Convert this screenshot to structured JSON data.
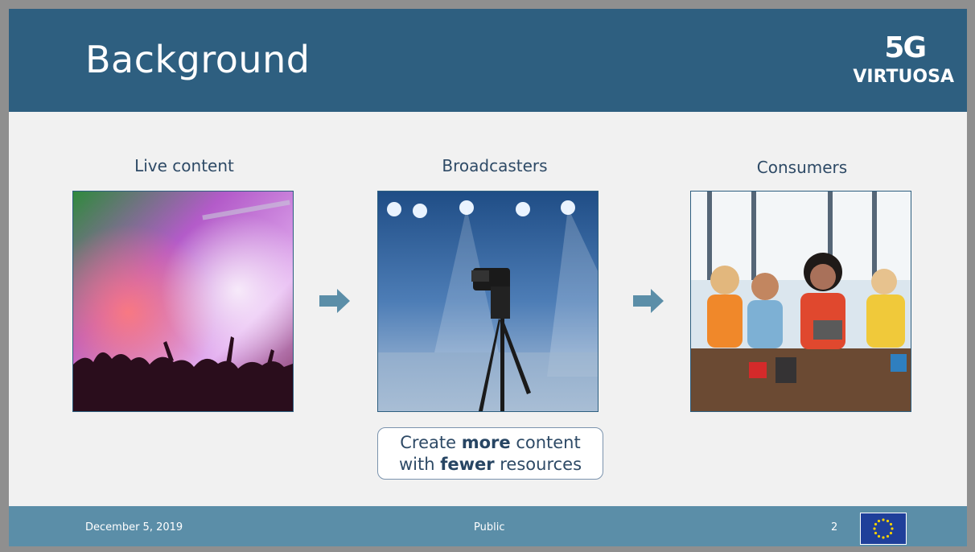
{
  "slide": {
    "title": "Background",
    "logo": {
      "top": "5G",
      "bottom": "VIRTUOSA"
    },
    "columns": [
      {
        "label": "Live content",
        "image": "concert-crowd"
      },
      {
        "label": "Broadcasters",
        "image": "video-camera-on-tripod"
      },
      {
        "label": "Consumers",
        "image": "people-using-devices"
      }
    ],
    "tagline": {
      "line1_pre": "Create ",
      "line1_bold": "more",
      "line1_post": " content",
      "line2_pre": "with ",
      "line2_bold": "fewer",
      "line2_post": " resources"
    }
  },
  "footer": {
    "date": "December 5, 2019",
    "classification": "Public",
    "page_number": "2"
  },
  "colors": {
    "header": "#2e5f80",
    "footer": "#5b8ea8",
    "arrow": "#5b8ea8",
    "text": "#2e4a66"
  },
  "icons": [
    "arrow-right-icon",
    "eu-flag-icon"
  ]
}
